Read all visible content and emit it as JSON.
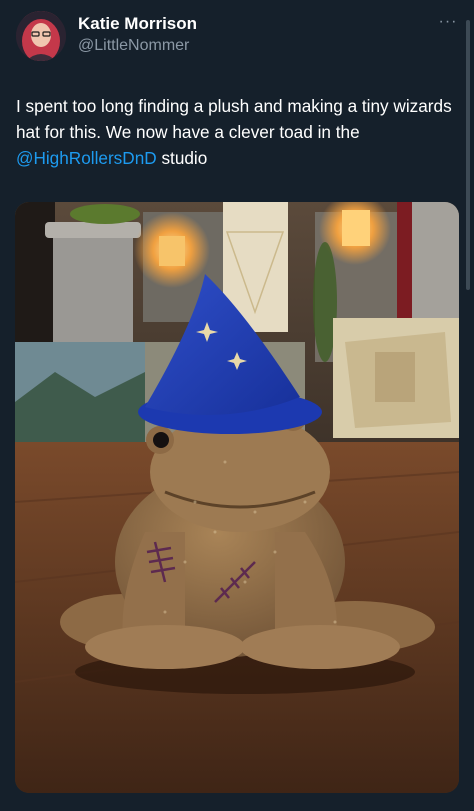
{
  "author": {
    "name": "Katie Morrison",
    "handle": "@LittleNommer"
  },
  "menu": {
    "more_label": "···"
  },
  "tweet": {
    "text_before": "I spent too long finding a plush and making a tiny wizards hat for this. We now have a clever toad in the ",
    "mention": "@HighRollersDnD",
    "text_after": " studio"
  },
  "icons": {
    "avatar": "profile-photo",
    "more": "more-options-icon"
  },
  "colors": {
    "background": "#15202b",
    "link": "#1d9bf0",
    "secondary_text": "#8b98a5"
  }
}
